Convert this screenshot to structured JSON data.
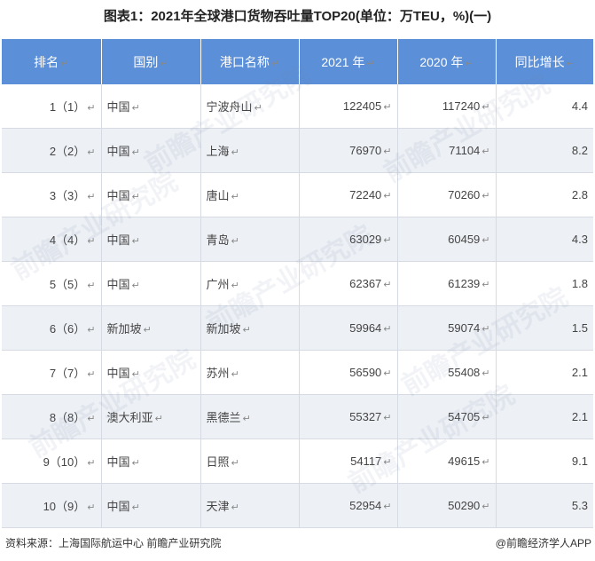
{
  "title": "图表1：2021年全球港口货物吞吐量TOP20(单位：万TEU，%)(一)",
  "colors": {
    "header_bg": "#5b8fd8",
    "alt_row": "#edf0f5",
    "border": "#d6dbe3"
  },
  "table": {
    "headers": [
      "排名",
      "国别",
      "港口名称",
      "2021 年",
      "2020 年",
      "同比增长"
    ],
    "paragraph_mark": "↵",
    "rows": [
      {
        "rank": "1（1）",
        "country": "中国",
        "port": "宁波舟山",
        "y2021": "122405",
        "y2020": "117240",
        "growth": "4.4"
      },
      {
        "rank": "2（2）",
        "country": "中国",
        "port": "上海",
        "y2021": "76970",
        "y2020": "71104",
        "growth": "8.2"
      },
      {
        "rank": "3（3）",
        "country": "中国",
        "port": "唐山",
        "y2021": "72240",
        "y2020": "70260",
        "growth": "2.8"
      },
      {
        "rank": "4（4）",
        "country": "中国",
        "port": "青岛",
        "y2021": "63029",
        "y2020": "60459",
        "growth": "4.3"
      },
      {
        "rank": "5（5）",
        "country": "中国",
        "port": "广州",
        "y2021": "62367",
        "y2020": "61239",
        "growth": "1.8"
      },
      {
        "rank": "6（6）",
        "country": "新加坡",
        "port": "新加坡",
        "y2021": "59964",
        "y2020": "59074",
        "growth": "1.5"
      },
      {
        "rank": "7（7）",
        "country": "中国",
        "port": "苏州",
        "y2021": "56590",
        "y2020": "55408",
        "growth": "2.1"
      },
      {
        "rank": "8（8）",
        "country": "澳大利亚",
        "port": "黑德兰",
        "y2021": "55327",
        "y2020": "54705",
        "growth": "2.1"
      },
      {
        "rank": "9（10）",
        "country": "中国",
        "port": "日照",
        "y2021": "54117",
        "y2020": "49615",
        "growth": "9.1"
      },
      {
        "rank": "10（9）",
        "country": "中国",
        "port": "天津",
        "y2021": "52954",
        "y2020": "50290",
        "growth": "5.3"
      }
    ]
  },
  "footer": {
    "source": "资料来源：上海国际航运中心 前瞻产业研究院",
    "brand": "@前瞻经济学人APP"
  },
  "watermark_text": "前瞻产业研究院"
}
